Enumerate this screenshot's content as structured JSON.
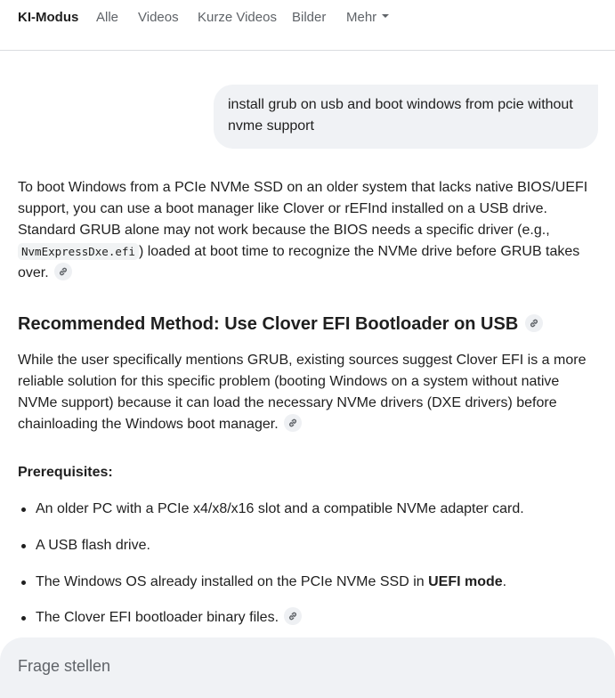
{
  "tabs": [
    {
      "label": "KI-Modus",
      "active": true
    },
    {
      "label": "Alle"
    },
    {
      "label": "Videos"
    },
    {
      "label": "Kurze Videos"
    },
    {
      "label": "Bilder"
    },
    {
      "label": "Mehr",
      "has_dropdown": true
    }
  ],
  "query": "install grub on usb and boot windows from pcie without nvme support",
  "answer": {
    "p1_before_code": "To boot Windows from a PCIe NVMe SSD on an older system that lacks native BIOS/UEFI support, you can use a boot manager like Clover or rEFInd installed on a USB drive. Standard GRUB alone may not work because the BIOS needs a specific driver (e.g., ",
    "p1_code": "NvmExpressDxe.efi",
    "p1_after_code": ") loaded at boot time to recognize the NVMe drive before GRUB takes over.",
    "heading": "Recommended Method: Use Clover EFI Bootloader on USB",
    "p2": "While the user specifically mentions GRUB, existing sources suggest Clover EFI is a more reliable solution for this specific problem (booting Windows on a system without native NVMe support) because it can load the necessary NVMe drivers (DXE drivers) before chainloading the Windows boot manager.",
    "prereq_heading": "Prerequisites:",
    "bullets": {
      "b1": "An older PC with a PCIe x4/x8/x16 slot and a compatible NVMe adapter card.",
      "b2": "A USB flash drive.",
      "b3_before": "The Windows OS already installed on the PCIe NVMe SSD in ",
      "b3_bold": "UEFI mode",
      "b3_after": ".",
      "b4": "The Clover EFI bootloader binary files."
    }
  },
  "input": {
    "placeholder": "Frage stellen"
  },
  "icons": {
    "source_link": "link-icon"
  },
  "colors": {
    "accent_text": "#1f1f1f",
    "muted_text": "#5f6368",
    "bubble_bg": "#f0f2f5"
  }
}
